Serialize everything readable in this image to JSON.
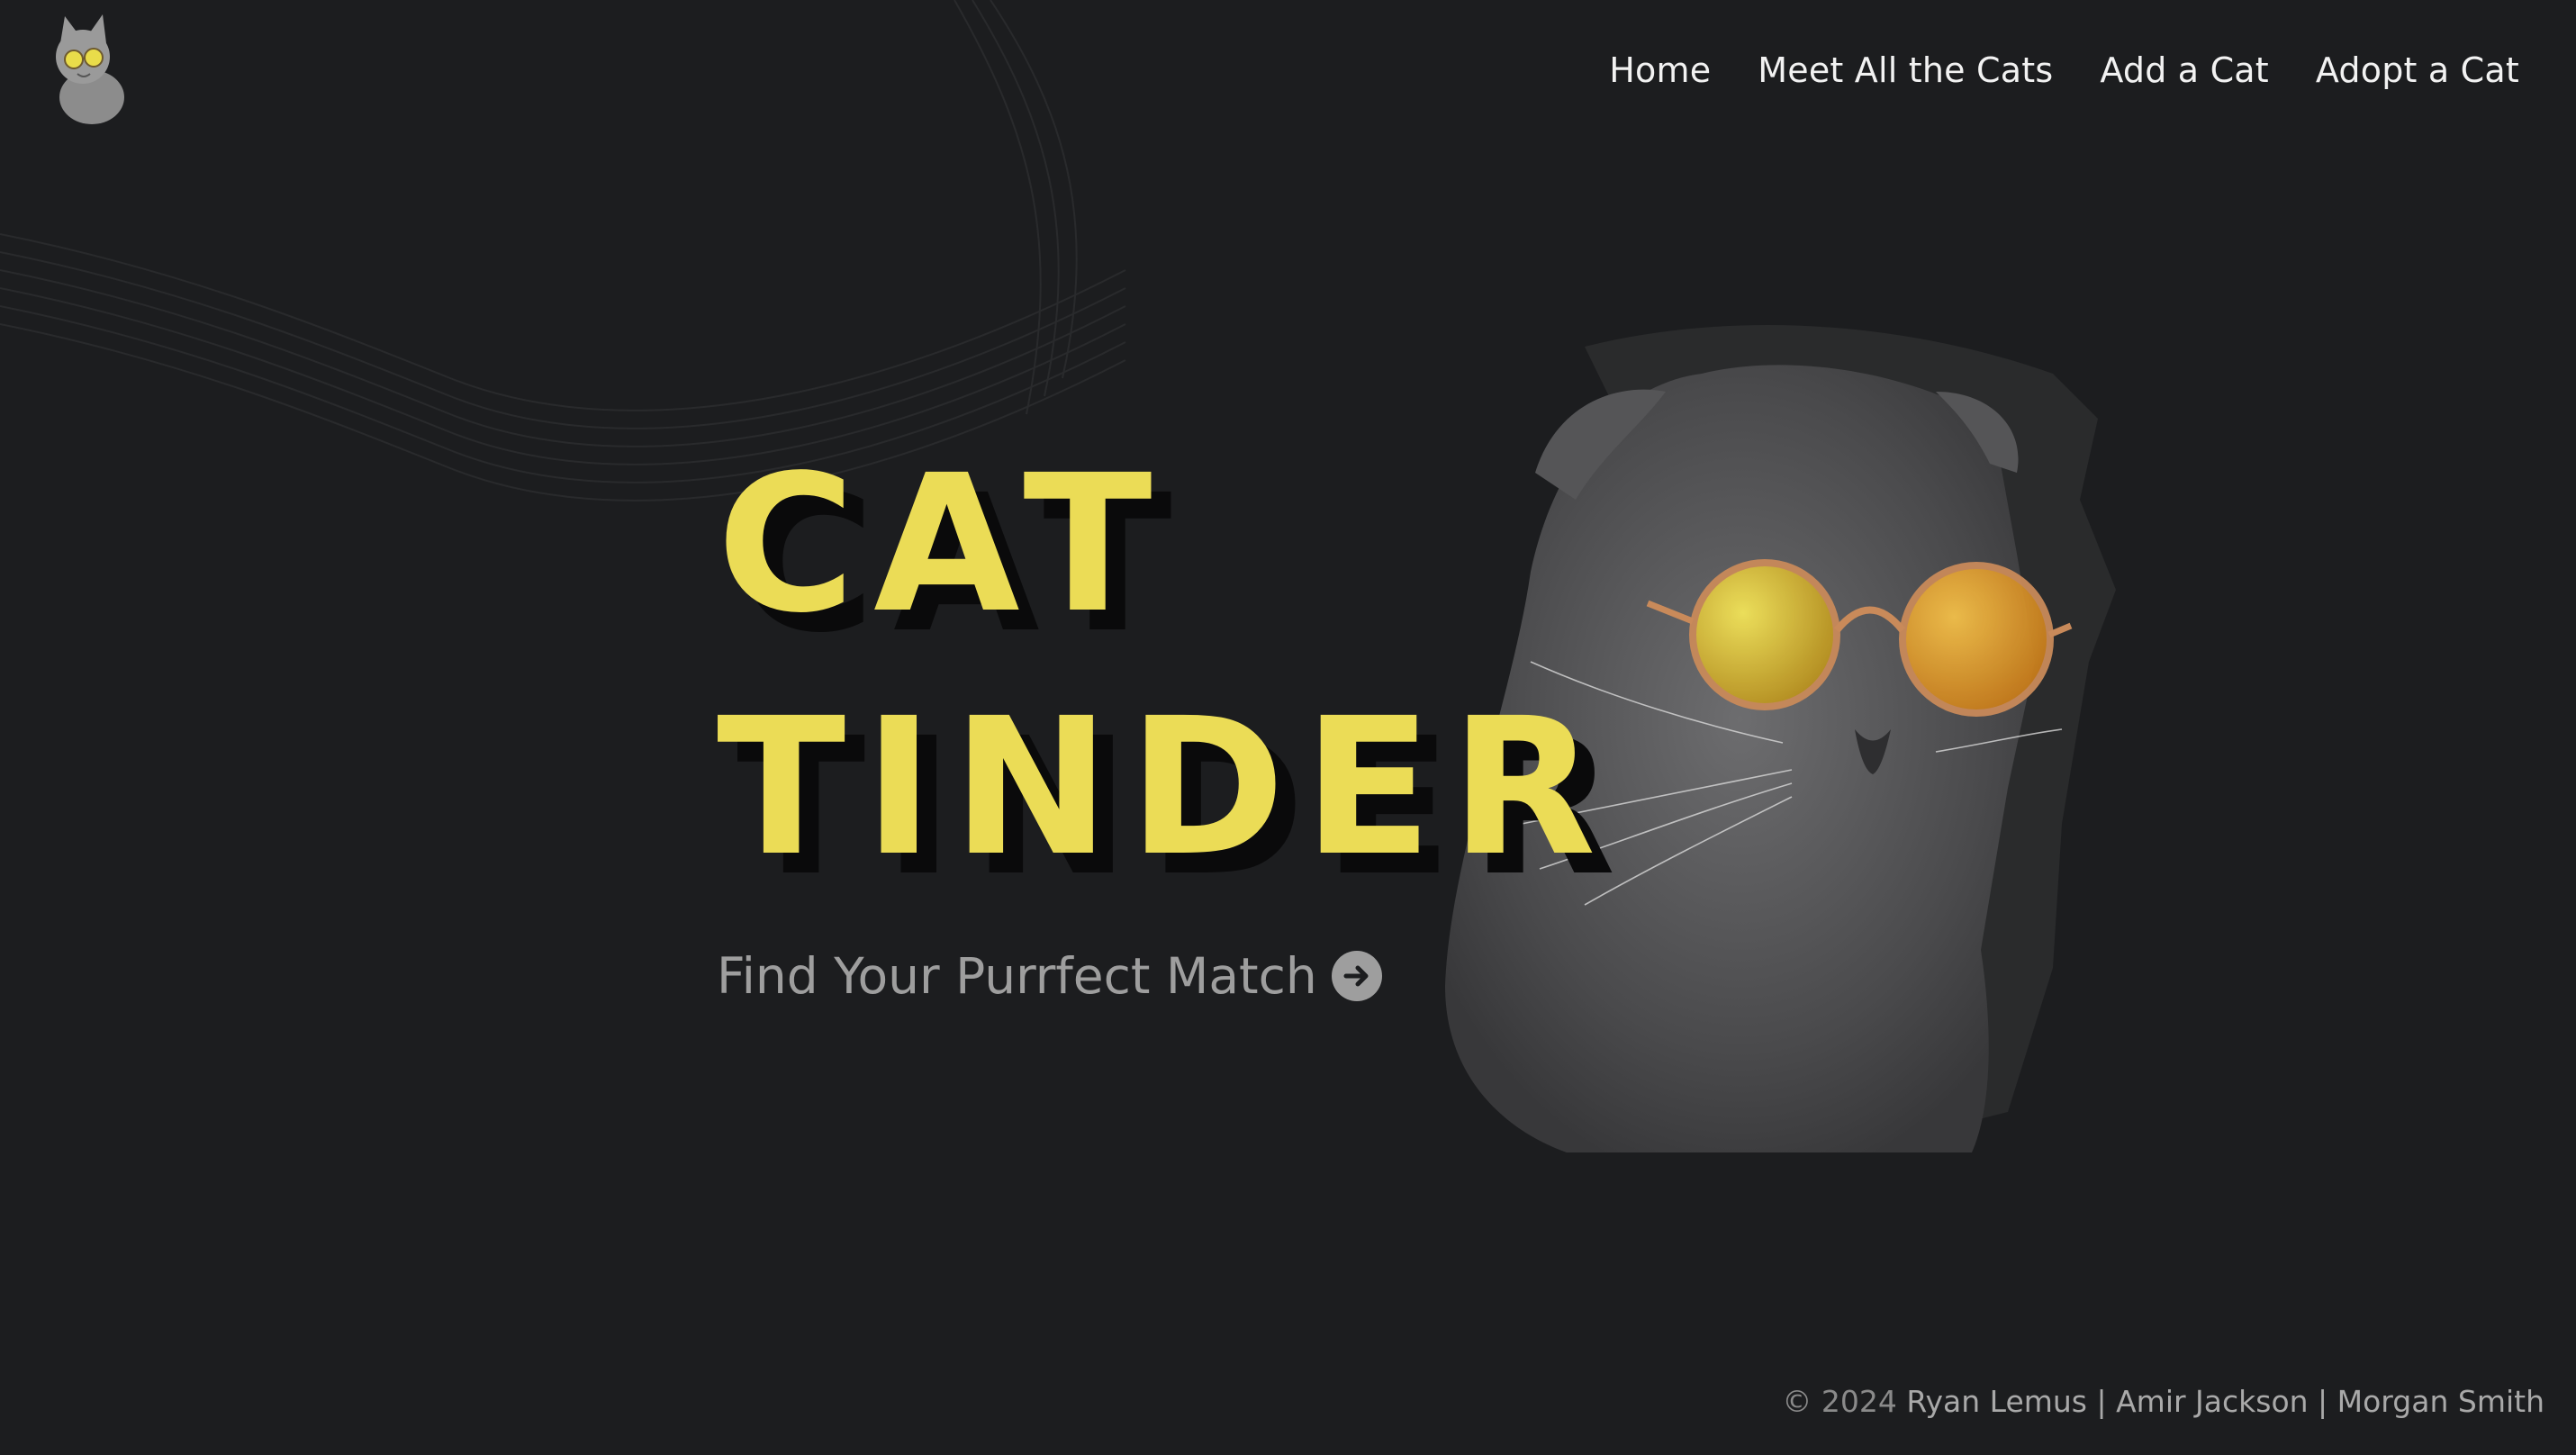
{
  "nav": {
    "items": [
      {
        "label": "Home"
      },
      {
        "label": "Meet All the Cats"
      },
      {
        "label": "Add a Cat"
      },
      {
        "label": "Adopt a Cat"
      }
    ]
  },
  "hero": {
    "title_line1": "CAT",
    "title_line2": "TINDER",
    "tagline": "Find Your Purrfect Match"
  },
  "footer": {
    "copyright": "© 2024",
    "authors": "Ryan Lemus | Amir Jackson | Morgan Smith"
  },
  "icons": {
    "logo": "cat-with-sunglasses-logo-icon",
    "tagline_arrow": "arrow-right-circle-icon"
  },
  "colors": {
    "background": "#1c1d1f",
    "accent": "#ebdc56",
    "nav_text": "#f2f2f2",
    "muted_text": "#9e9e9e"
  }
}
